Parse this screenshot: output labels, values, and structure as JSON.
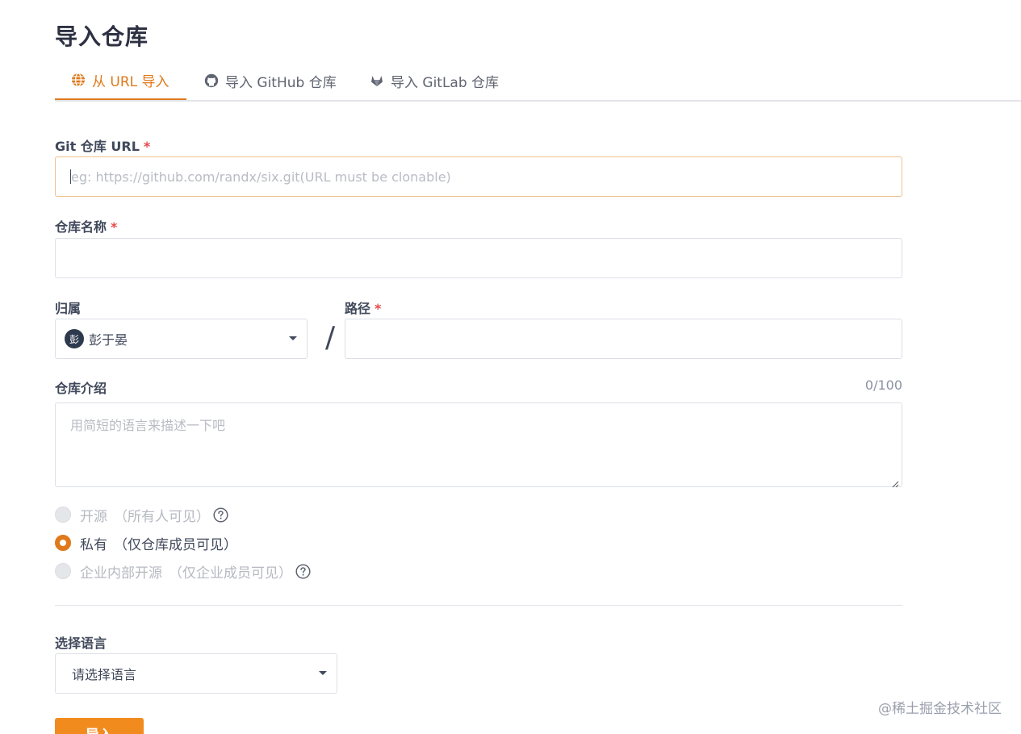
{
  "page": {
    "title": "导入仓库"
  },
  "tabs": [
    {
      "label": "从 URL 导入",
      "icon": "globe-icon",
      "active": true
    },
    {
      "label": "导入 GitHub 仓库",
      "icon": "github-icon",
      "active": false
    },
    {
      "label": "导入 GitLab 仓库",
      "icon": "gitlab-icon",
      "active": false
    }
  ],
  "form": {
    "git_url": {
      "label": "Git 仓库 URL",
      "required_mark": "*",
      "value": "",
      "placeholder": "eg: https://github.com/randx/six.git(URL must be clonable)"
    },
    "repo_name": {
      "label": "仓库名称",
      "required_mark": "*",
      "value": ""
    },
    "owner": {
      "label": "归属",
      "avatar_text": "彭",
      "value": "彭于晏"
    },
    "separator": "/",
    "path": {
      "label": "路径",
      "required_mark": "*",
      "value": ""
    },
    "description": {
      "label": "仓库介绍",
      "counter": "0/100",
      "placeholder": "用简短的语言来描述一下吧"
    },
    "visibility": [
      {
        "label": "开源",
        "note": "（所有人可见）",
        "checked": false,
        "disabled": true,
        "help": true
      },
      {
        "label": "私有",
        "note": "（仅仓库成员可见）",
        "checked": true,
        "disabled": false,
        "help": false
      },
      {
        "label": "企业内部开源",
        "note": "（仅企业成员可见）",
        "checked": false,
        "disabled": true,
        "help": true
      }
    ],
    "language": {
      "label": "选择语言",
      "value": "请选择语言"
    },
    "submit_label": "导入"
  },
  "watermark": "@稀土掘金技术社区",
  "colors": {
    "accent": "#e0791b",
    "button": "#f28b1e",
    "required": "#e8484a"
  }
}
